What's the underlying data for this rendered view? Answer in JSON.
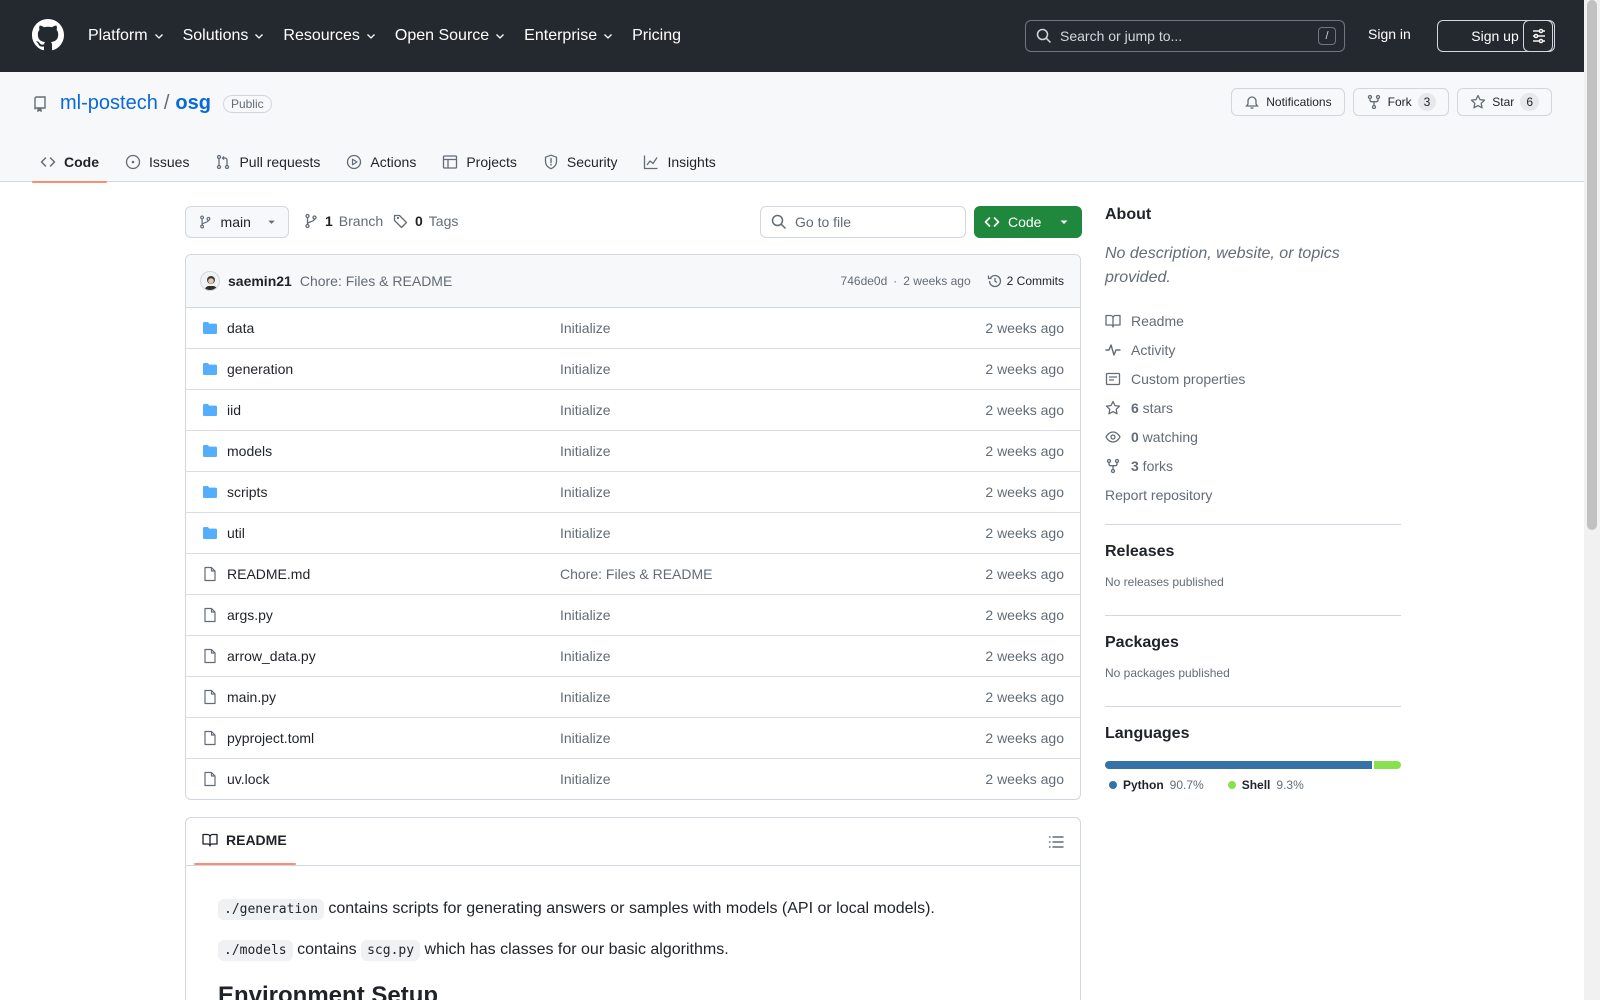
{
  "header": {
    "nav": [
      "Platform",
      "Solutions",
      "Resources",
      "Open Source",
      "Enterprise",
      "Pricing"
    ],
    "nav_has_chevron": [
      true,
      true,
      true,
      true,
      true,
      false
    ],
    "search_placeholder": "Search or jump to...",
    "search_shortcut": "/",
    "sign_in": "Sign in",
    "sign_up": "Sign up"
  },
  "repo": {
    "owner": "ml-postech",
    "separator": "/",
    "name": "osg",
    "visibility": "Public",
    "notifications_label": "Notifications",
    "fork_label": "Fork",
    "fork_count": "3",
    "star_label": "Star",
    "star_count": "6"
  },
  "tabs": [
    {
      "label": "Code",
      "icon": "code-icon",
      "active": true
    },
    {
      "label": "Issues",
      "icon": "issue-icon",
      "active": false
    },
    {
      "label": "Pull requests",
      "icon": "pull-request-icon",
      "active": false
    },
    {
      "label": "Actions",
      "icon": "play-icon",
      "active": false
    },
    {
      "label": "Projects",
      "icon": "table-icon",
      "active": false
    },
    {
      "label": "Security",
      "icon": "shield-icon",
      "active": false
    },
    {
      "label": "Insights",
      "icon": "graph-icon",
      "active": false
    }
  ],
  "toolbar": {
    "branch": "main",
    "branch_count": "1",
    "branch_label": "Branch",
    "tag_count": "0",
    "tag_label": "Tags",
    "goto_placeholder": "Go to file",
    "code_button": "Code"
  },
  "latest_commit": {
    "author": "saemin21",
    "message": "Chore: Files & README",
    "hash": "746de0d",
    "dot": "·",
    "time": "2 weeks ago",
    "commits_label": "2 Commits"
  },
  "files": [
    {
      "name": "data",
      "type": "dir",
      "message": "Initialize",
      "date": "2 weeks ago"
    },
    {
      "name": "generation",
      "type": "dir",
      "message": "Initialize",
      "date": "2 weeks ago"
    },
    {
      "name": "iid",
      "type": "dir",
      "message": "Initialize",
      "date": "2 weeks ago"
    },
    {
      "name": "models",
      "type": "dir",
      "message": "Initialize",
      "date": "2 weeks ago"
    },
    {
      "name": "scripts",
      "type": "dir",
      "message": "Initialize",
      "date": "2 weeks ago"
    },
    {
      "name": "util",
      "type": "dir",
      "message": "Initialize",
      "date": "2 weeks ago"
    },
    {
      "name": "README.md",
      "type": "file",
      "message": "Chore: Files & README",
      "date": "2 weeks ago"
    },
    {
      "name": "args.py",
      "type": "file",
      "message": "Initialize",
      "date": "2 weeks ago"
    },
    {
      "name": "arrow_data.py",
      "type": "file",
      "message": "Initialize",
      "date": "2 weeks ago"
    },
    {
      "name": "main.py",
      "type": "file",
      "message": "Initialize",
      "date": "2 weeks ago"
    },
    {
      "name": "pyproject.toml",
      "type": "file",
      "message": "Initialize",
      "date": "2 weeks ago"
    },
    {
      "name": "uv.lock",
      "type": "file",
      "message": "Initialize",
      "date": "2 weeks ago"
    }
  ],
  "readme": {
    "tab_label": "README",
    "line1_code": "./generation",
    "line1_text": " contains scripts for generating answers or samples with models (API or local models).",
    "line2_code": "./models",
    "line2_mid": " contains ",
    "line2_code2": "scg.py",
    "line2_text": " which has classes for our basic algorithms.",
    "heading": "Environment Setup"
  },
  "sidebar": {
    "about_title": "About",
    "about_desc": "No description, website, or topics provided.",
    "links": [
      {
        "icon": "book-icon",
        "count": "",
        "label": "Readme"
      },
      {
        "icon": "pulse-icon",
        "count": "",
        "label": "Activity"
      },
      {
        "icon": "note-icon",
        "count": "",
        "label": "Custom properties"
      },
      {
        "icon": "star-icon",
        "count": "6",
        "label": " stars"
      },
      {
        "icon": "eye-icon",
        "count": "0",
        "label": " watching"
      },
      {
        "icon": "fork-icon",
        "count": "3",
        "label": " forks"
      }
    ],
    "report": "Report repository",
    "releases_title": "Releases",
    "releases_sub": "No releases published",
    "packages_title": "Packages",
    "packages_sub": "No packages published",
    "languages_title": "Languages",
    "languages": [
      {
        "name": "Python",
        "percent": "90.7%",
        "value": 90.7,
        "color": "#3572A5"
      },
      {
        "name": "Shell",
        "percent": "9.3%",
        "value": 9.3,
        "color": "#89e051"
      }
    ]
  },
  "colors": {
    "header_bg": "#24292f",
    "link": "#0969da",
    "primary_button": "#1f883d",
    "tab_underline": "#fd8c73",
    "folder": "#54aeff"
  }
}
